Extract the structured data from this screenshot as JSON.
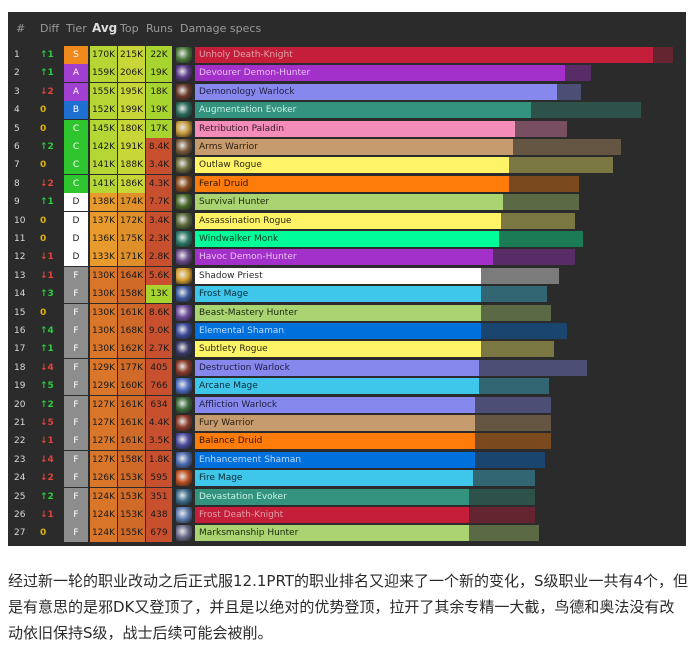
{
  "header": {
    "rank": "#",
    "diff": "Diff",
    "tier": "Tier",
    "avg": "Avg",
    "top": "Top",
    "runs": "Runs",
    "specs": "Damage specs"
  },
  "tier_colors": {
    "S": "#f08a1c",
    "A": "#a03fd0",
    "B": "#1f6fd0",
    "C": "#2fc52f",
    "D": "#ffffff",
    "F": "#8d8d8d"
  },
  "diff_colors": {
    "up": "#2ecc40",
    "down": "#e0443a",
    "same": "#e0b20f"
  },
  "rows": [
    {
      "rank": "1",
      "diff": "↑1",
      "dir": "up",
      "tier": "S",
      "avg": "170K",
      "top": "215K",
      "runs": "22K",
      "spec": "Unholy Death-Knight",
      "color": "#c41e3a",
      "text": "#e0a0a8",
      "avgFrac": 0.958,
      "topFrac": 1.0,
      "icon": "unholy-death-knight-icon",
      "iconColor": "#4a7a3a"
    },
    {
      "rank": "2",
      "diff": "↑1",
      "dir": "up",
      "tier": "A",
      "avg": "159K",
      "top": "206K",
      "runs": "19K",
      "spec": "Devourer Demon-Hunter",
      "color": "#a330c9",
      "text": "#e4c0f0",
      "avgFrac": 0.774,
      "topFrac": 0.828,
      "icon": "devourer-demon-hunter-icon",
      "iconColor": "#5a3a8a"
    },
    {
      "rank": "3",
      "diff": "↓2",
      "dir": "down",
      "tier": "A",
      "avg": "155K",
      "top": "195K",
      "runs": "18K",
      "spec": "Demonology Warlock",
      "color": "#8788ee",
      "text": "#1e1e40",
      "avgFrac": 0.757,
      "topFrac": 0.808,
      "icon": "demonology-warlock-icon",
      "iconColor": "#6a3a2a"
    },
    {
      "rank": "4",
      "diff": "0",
      "dir": "same",
      "tier": "B",
      "avg": "152K",
      "top": "199K",
      "runs": "19K",
      "spec": "Augmentation Evoker",
      "color": "#33937f",
      "text": "#c8f0e6",
      "avgFrac": 0.703,
      "topFrac": 0.933,
      "icon": "augmentation-evoker-icon",
      "iconColor": "#2a6a5a"
    },
    {
      "rank": "5",
      "diff": "0",
      "dir": "same",
      "tier": "C",
      "avg": "145K",
      "top": "180K",
      "runs": "17K",
      "spec": "Retribution Paladin",
      "color": "#f48cba",
      "text": "#3a1a2a",
      "avgFrac": 0.669,
      "topFrac": 0.778,
      "icon": "retribution-paladin-icon",
      "iconColor": "#c89a3a"
    },
    {
      "rank": "6",
      "diff": "↑2",
      "dir": "up",
      "tier": "C",
      "avg": "142K",
      "top": "191K",
      "runs": "8.4K",
      "spec": "Arms Warrior",
      "color": "#c69b6d",
      "text": "#2a1e10",
      "avgFrac": 0.665,
      "topFrac": 0.891,
      "icon": "arms-warrior-icon",
      "iconColor": "#7a5a3a"
    },
    {
      "rank": "7",
      "diff": "0",
      "dir": "same",
      "tier": "C",
      "avg": "141K",
      "top": "188K",
      "runs": "3.4K",
      "spec": "Outlaw Rogue",
      "color": "#fff468",
      "text": "#2a2810",
      "avgFrac": 0.657,
      "topFrac": 0.875,
      "icon": "outlaw-rogue-icon",
      "iconColor": "#6a6a3a"
    },
    {
      "rank": "8",
      "diff": "↓2",
      "dir": "down",
      "tier": "C",
      "avg": "141K",
      "top": "186K",
      "runs": "4.3K",
      "spec": "Feral Druid",
      "color": "#ff7c0a",
      "text": "#2a1400",
      "avgFrac": 0.657,
      "topFrac": 0.803,
      "icon": "feral-druid-icon",
      "iconColor": "#8a4a1a"
    },
    {
      "rank": "9",
      "diff": "↑1",
      "dir": "up",
      "tier": "D",
      "avg": "138K",
      "top": "174K",
      "runs": "7.7K",
      "spec": "Survival Hunter",
      "color": "#aad372",
      "text": "#1a2a10",
      "avgFrac": 0.644,
      "topFrac": 0.803,
      "icon": "survival-hunter-icon",
      "iconColor": "#4a6a2a"
    },
    {
      "rank": "10",
      "diff": "0",
      "dir": "same",
      "tier": "D",
      "avg": "137K",
      "top": "172K",
      "runs": "3.4K",
      "spec": "Assassination Rogue",
      "color": "#fff468",
      "text": "#2a2810",
      "avgFrac": 0.64,
      "topFrac": 0.795,
      "icon": "assassination-rogue-icon",
      "iconColor": "#5a6a3a"
    },
    {
      "rank": "11",
      "diff": "0",
      "dir": "same",
      "tier": "D",
      "avg": "136K",
      "top": "175K",
      "runs": "2.3K",
      "spec": "Windwalker Monk",
      "color": "#00ff98",
      "text": "#003a22",
      "avgFrac": 0.635,
      "topFrac": 0.812,
      "icon": "windwalker-monk-icon",
      "iconColor": "#2a7a6a"
    },
    {
      "rank": "12",
      "diff": "↓1",
      "dir": "down",
      "tier": "D",
      "avg": "133K",
      "top": "171K",
      "runs": "2.8K",
      "spec": "Havoc Demon-Hunter",
      "color": "#a330c9",
      "text": "#e4c0f0",
      "avgFrac": 0.623,
      "topFrac": 0.795,
      "icon": "havoc-demon-hunter-icon",
      "iconColor": "#6a4a8a"
    },
    {
      "rank": "13",
      "diff": "↓1",
      "dir": "down",
      "tier": "F",
      "avg": "130K",
      "top": "164K",
      "runs": "5.6K",
      "spec": "Shadow Priest",
      "color": "#ffffff",
      "text": "#2a2a2a",
      "avgFrac": 0.598,
      "topFrac": 0.762,
      "icon": "shadow-priest-icon",
      "iconColor": "#d8a030"
    },
    {
      "rank": "14",
      "diff": "↑3",
      "dir": "up",
      "tier": "F",
      "avg": "130K",
      "top": "158K",
      "runs": "13K",
      "spec": "Frost Mage",
      "color": "#3fc7eb",
      "text": "#0a2a34",
      "avgFrac": 0.598,
      "topFrac": 0.736,
      "icon": "frost-mage-icon",
      "iconColor": "#3a5aa0"
    },
    {
      "rank": "15",
      "diff": "0",
      "dir": "same",
      "tier": "F",
      "avg": "130K",
      "top": "161K",
      "runs": "8.6K",
      "spec": "Beast-Mastery Hunter",
      "color": "#aad372",
      "text": "#1a2a10",
      "avgFrac": 0.598,
      "topFrac": 0.745,
      "icon": "beast-mastery-hunter-icon",
      "iconColor": "#6a4a9a"
    },
    {
      "rank": "16",
      "diff": "↑4",
      "dir": "up",
      "tier": "F",
      "avg": "130K",
      "top": "168K",
      "runs": "9.0K",
      "spec": "Elemental Shaman",
      "color": "#0070dd",
      "text": "#c0dcff",
      "avgFrac": 0.598,
      "topFrac": 0.778,
      "icon": "elemental-shaman-icon",
      "iconColor": "#3a4a9a"
    },
    {
      "rank": "17",
      "diff": "↑1",
      "dir": "up",
      "tier": "F",
      "avg": "130K",
      "top": "162K",
      "runs": "2.7K",
      "spec": "Subtlety Rogue",
      "color": "#fff468",
      "text": "#2a2810",
      "avgFrac": 0.598,
      "topFrac": 0.751,
      "icon": "subtlety-rogue-icon",
      "iconColor": "#3a3a6a"
    },
    {
      "rank": "18",
      "diff": "↓4",
      "dir": "down",
      "tier": "F",
      "avg": "129K",
      "top": "177K",
      "runs": "405",
      "spec": "Destruction Warlock",
      "color": "#8788ee",
      "text": "#1e1e40",
      "avgFrac": 0.594,
      "topFrac": 0.82,
      "icon": "destruction-warlock-icon",
      "iconColor": "#8a3a2a"
    },
    {
      "rank": "19",
      "diff": "↑5",
      "dir": "up",
      "tier": "F",
      "avg": "129K",
      "top": "160K",
      "runs": "766",
      "spec": "Arcane Mage",
      "color": "#3fc7eb",
      "text": "#0a2a34",
      "avgFrac": 0.594,
      "topFrac": 0.741,
      "icon": "arcane-mage-icon",
      "iconColor": "#4a6ac0"
    },
    {
      "rank": "20",
      "diff": "↑2",
      "dir": "up",
      "tier": "F",
      "avg": "127K",
      "top": "161K",
      "runs": "634",
      "spec": "Affliction Warlock",
      "color": "#8788ee",
      "text": "#1e1e40",
      "avgFrac": 0.586,
      "topFrac": 0.745,
      "icon": "affliction-warlock-icon",
      "iconColor": "#3a6a3a"
    },
    {
      "rank": "21",
      "diff": "↓5",
      "dir": "down",
      "tier": "F",
      "avg": "127K",
      "top": "161K",
      "runs": "4.4K",
      "spec": "Fury Warrior",
      "color": "#c69b6d",
      "text": "#2a1e10",
      "avgFrac": 0.586,
      "topFrac": 0.745,
      "icon": "fury-warrior-icon",
      "iconColor": "#8a3a2a"
    },
    {
      "rank": "22",
      "diff": "↓1",
      "dir": "down",
      "tier": "F",
      "avg": "127K",
      "top": "161K",
      "runs": "3.5K",
      "spec": "Balance Druid",
      "color": "#ff7c0a",
      "text": "#2a1400",
      "avgFrac": 0.586,
      "topFrac": 0.745,
      "icon": "balance-druid-icon",
      "iconColor": "#4a4aa0"
    },
    {
      "rank": "23",
      "diff": "↓4",
      "dir": "down",
      "tier": "F",
      "avg": "127K",
      "top": "158K",
      "runs": "1.8K",
      "spec": "Enhancement Shaman",
      "color": "#0070dd",
      "text": "#c0dcff",
      "avgFrac": 0.586,
      "topFrac": 0.732,
      "icon": "enhancement-shaman-icon",
      "iconColor": "#4a6ab0"
    },
    {
      "rank": "24",
      "diff": "↓2",
      "dir": "down",
      "tier": "F",
      "avg": "126K",
      "top": "153K",
      "runs": "595",
      "spec": "Fire Mage",
      "color": "#3fc7eb",
      "text": "#0a2a34",
      "avgFrac": 0.582,
      "topFrac": 0.711,
      "icon": "fire-mage-icon",
      "iconColor": "#c05020"
    },
    {
      "rank": "25",
      "diff": "↑2",
      "dir": "up",
      "tier": "F",
      "avg": "124K",
      "top": "153K",
      "runs": "351",
      "spec": "Devastation Evoker",
      "color": "#33937f",
      "text": "#c8f0e6",
      "avgFrac": 0.573,
      "topFrac": 0.711,
      "icon": "devastation-evoker-icon",
      "iconColor": "#3a6a8a"
    },
    {
      "rank": "26",
      "diff": "↓1",
      "dir": "down",
      "tier": "F",
      "avg": "124K",
      "top": "153K",
      "runs": "438",
      "spec": "Frost Death-Knight",
      "color": "#c41e3a",
      "text": "#e0a0a8",
      "avgFrac": 0.573,
      "topFrac": 0.711,
      "icon": "frost-death-knight-icon",
      "iconColor": "#5a7ab0"
    },
    {
      "rank": "27",
      "diff": "0",
      "dir": "same",
      "tier": "F",
      "avg": "124K",
      "top": "155K",
      "runs": "679",
      "spec": "Marksmanship Hunter",
      "color": "#aad372",
      "text": "#1a2a10",
      "avgFrac": 0.573,
      "topFrac": 0.72,
      "icon": "marksmanship-hunter-icon",
      "iconColor": "#6a6a8a"
    }
  ],
  "caption": "经过新一轮的职业改动之后正式服12.1PRT的职业排名又迎来了一个新的变化，S级职业一共有4个，但是有意思的是邪DK又登顶了，并且是以绝对的优势登顶，拉开了其余专精一大截，鸟德和奥法没有改动依旧保持S级，战士后续可能会被削。"
}
